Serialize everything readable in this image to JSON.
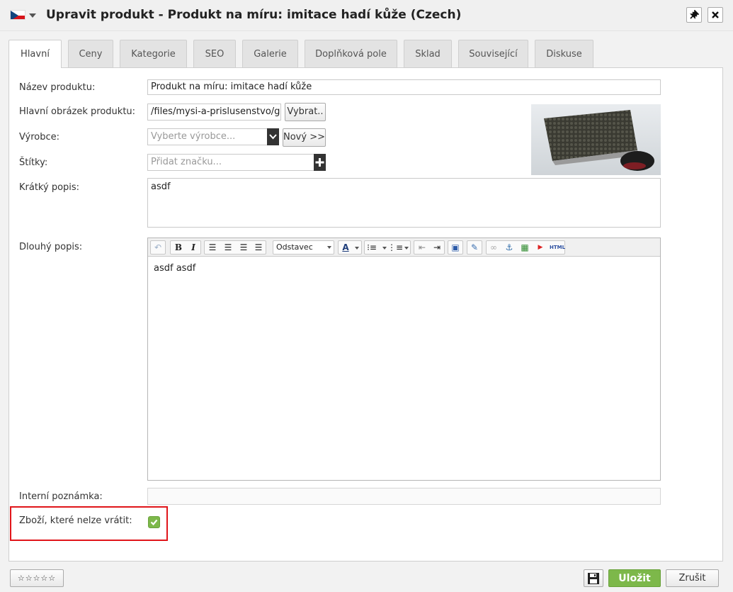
{
  "header": {
    "title": "Upravit produkt - Produkt na míru: imitace hadí kůže (Czech)",
    "flag_icon": "czech-flag-icon",
    "pin_icon": "pin-icon",
    "close_icon": "close-icon"
  },
  "tabs": [
    {
      "label": "Hlavní",
      "active": true
    },
    {
      "label": "Ceny"
    },
    {
      "label": "Kategorie"
    },
    {
      "label": "SEO"
    },
    {
      "label": "Galerie"
    },
    {
      "label": "Doplňková pole"
    },
    {
      "label": "Sklad"
    },
    {
      "label": "Související"
    },
    {
      "label": "Diskuse"
    }
  ],
  "form": {
    "name_label": "Název produktu:",
    "name_value": "Produkt na míru: imitace hadí kůže",
    "image_label": "Hlavní obrázek produktu:",
    "image_value": "/files/mysi-a-prislusenstvo/ger",
    "image_button": "Vybrat..",
    "maker_label": "Výrobce:",
    "maker_placeholder": "Vyberte výrobce...",
    "maker_new_button": "Nový >>",
    "tags_label": "Štítky:",
    "tags_placeholder": "Přidat značku...",
    "short_label": "Krátký popis:",
    "short_value": "asdf",
    "long_label": "Dlouhý popis:",
    "long_value": "asdf asdf",
    "format_value": "Odstavec",
    "note_label": "Interní poznámka:",
    "note_value": "",
    "nonreturn_label": "Zboží, které nelze vrátit:",
    "nonreturn_checked": true
  },
  "footer": {
    "rating": "☆☆☆☆☆",
    "save_label": "Uložit",
    "cancel_label": "Zrušit"
  },
  "colors": {
    "save_green": "#7db84a",
    "highlight_red": "#e0151a"
  }
}
